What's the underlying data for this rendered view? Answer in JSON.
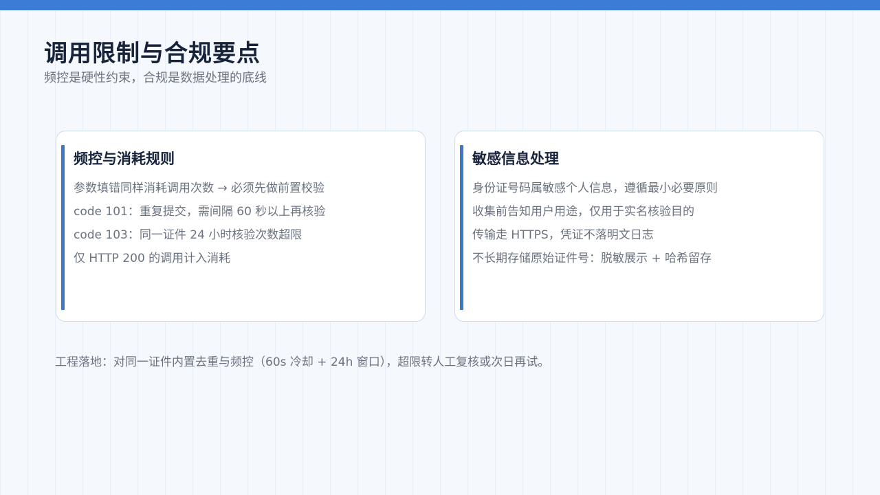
{
  "header": {
    "title": "调用限制与合规要点",
    "subtitle": "频控是硬性约束，合规是数据处理的底线"
  },
  "cards": [
    {
      "title": "频控与消耗规则",
      "items": [
        "参数填错同样消耗调用次数 → 必须先做前置校验",
        "code 101：重复提交，需间隔 60 秒以上再核验",
        "code 103：同一证件 24 小时核验次数超限",
        "仅 HTTP 200 的调用计入消耗"
      ]
    },
    {
      "title": "敏感信息处理",
      "items": [
        "身份证号码属敏感个人信息，遵循最小必要原则",
        "收集前告知用户用途，仅用于实名核验目的",
        "传输走 HTTPS，凭证不落明文日志",
        "不长期存储原始证件号：脱敏展示 + 哈希留存"
      ]
    }
  ],
  "footnote": "工程落地：对同一证件内置去重与频控（60s 冷却 + 24h 窗口），超限转人工复核或次日再试。",
  "colors": {
    "accent": "#3c7bd6",
    "title": "#17233a",
    "muted": "#6b7380"
  }
}
